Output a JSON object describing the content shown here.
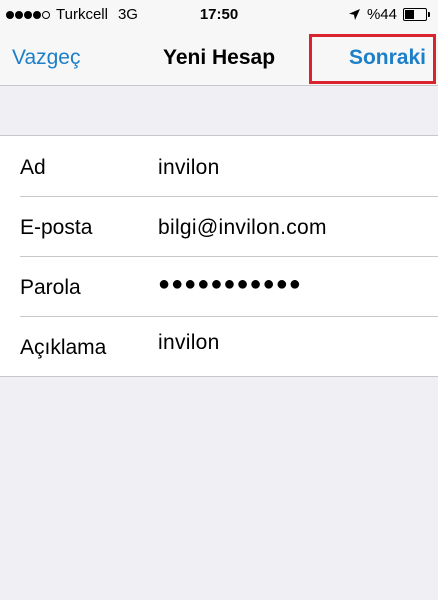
{
  "status_bar": {
    "carrier": "Turkcell",
    "network": "3G",
    "time": "17:50",
    "battery_text": "%44",
    "battery_level": 0.44,
    "signal_bars_filled": 4,
    "signal_bars_total": 5,
    "location_icon": "location-arrow-icon"
  },
  "nav": {
    "cancel_label": "Vazgeç",
    "title": "Yeni Hesap",
    "next_label": "Sonraki",
    "accent_color": "#1d7fc8",
    "highlight_color": "#d9232e"
  },
  "form": {
    "rows": [
      {
        "label": "Ad",
        "value": "invilon"
      },
      {
        "label": "E-posta",
        "value": "bilgi@invilon.com"
      },
      {
        "label": "Parola",
        "value": "●●●●●●●●●●●"
      },
      {
        "label": "Açıklama",
        "value": "invilon"
      }
    ]
  }
}
